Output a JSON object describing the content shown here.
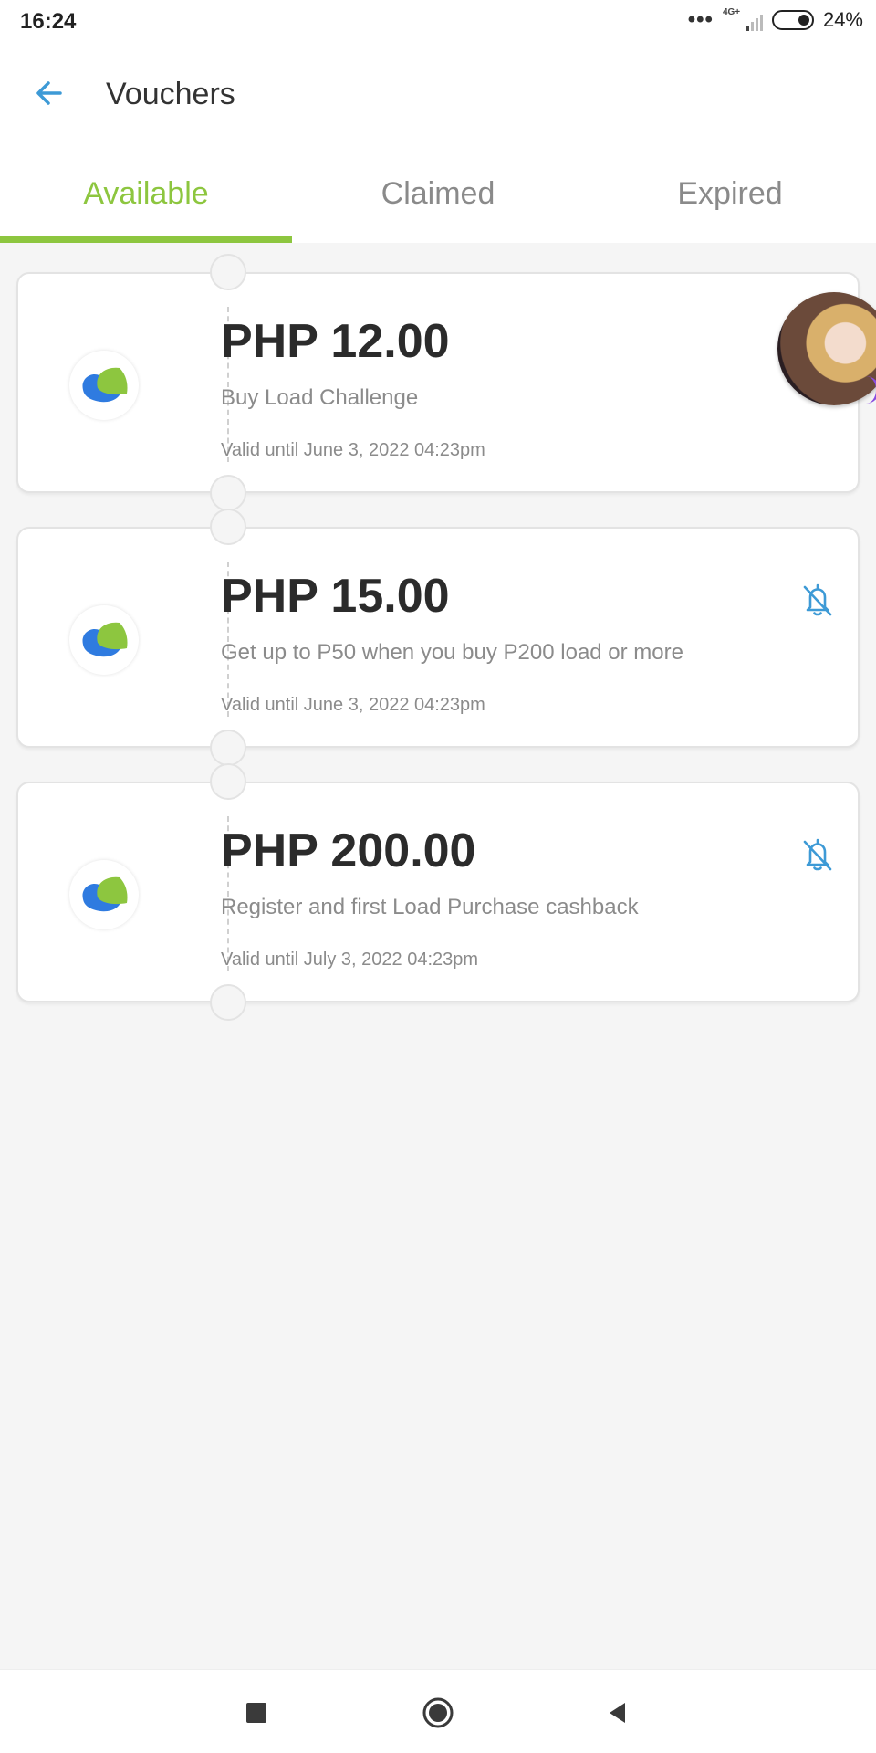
{
  "status_bar": {
    "time": "16:24",
    "network": "4G+",
    "battery": "24%"
  },
  "header": {
    "title": "Vouchers",
    "back_icon": "arrow-left-icon"
  },
  "tabs": [
    {
      "label": "Available",
      "active": true
    },
    {
      "label": "Claimed",
      "active": false
    },
    {
      "label": "Expired",
      "active": false
    }
  ],
  "vouchers": [
    {
      "amount": "PHP 12.00",
      "description": "Buy Load Challenge",
      "validity": "Valid until June 3, 2022 04:23pm",
      "show_bell": false
    },
    {
      "amount": "PHP 15.00",
      "description": "Get up to P50 when you buy P200 load or more",
      "validity": "Valid until June 3, 2022 04:23pm",
      "show_bell": true
    },
    {
      "amount": "PHP 200.00",
      "description": "Register and first Load Purchase cashback",
      "validity": "Valid until July 3, 2022 04:23pm",
      "show_bell": true
    }
  ],
  "colors": {
    "accent": "#8dc63f",
    "icon_blue": "#3d9ad6",
    "logo_blue": "#2f7be0",
    "logo_green": "#8dc63f"
  },
  "nav": {
    "icons": [
      "recent-apps-icon",
      "home-icon",
      "back-icon"
    ]
  }
}
